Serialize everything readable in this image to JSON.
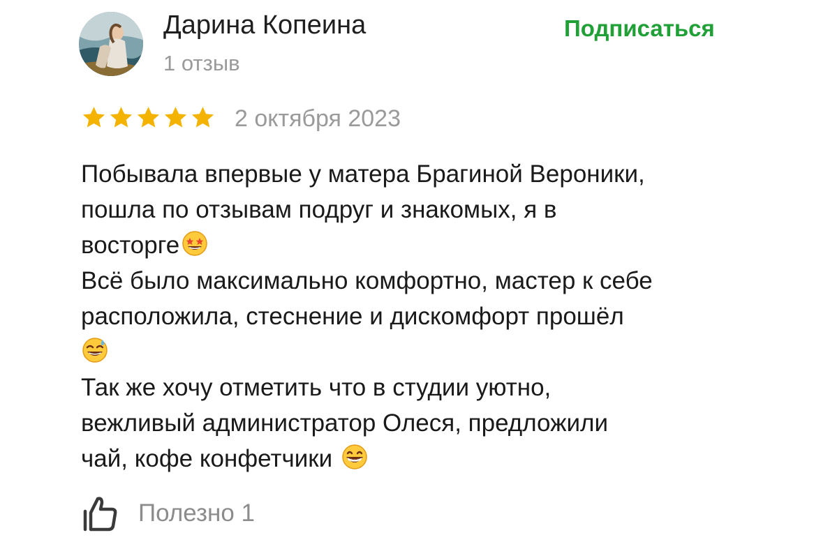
{
  "author": {
    "name": "Дарина Копеина",
    "reviews_count": "1 отзыв",
    "avatar_icon": "user-photo"
  },
  "subscribe_label": "Подписаться",
  "review": {
    "rating": 5,
    "rating_max": 5,
    "date": "2 октября 2023",
    "lines": [
      "Побывала впервые у матера Брагиной Вероники,",
      "пошла по отзывам подруг и знакомых, я в",
      "восторге",
      "Всё было максимально комфортно, мастер к себе",
      "расположила, стеснение и дискомфорт прошёл",
      "",
      "Так же хочу отметить что в студии уютно,",
      "вежливый администратор Олеся, предложили",
      "чай, кофе конфетчики"
    ],
    "emojis": {
      "star_struck": "🤩",
      "sweat_smile": "😅",
      "grin": "😁"
    }
  },
  "helpful": {
    "label": "Полезно",
    "count": "1",
    "icon": "thumbs-up-icon"
  },
  "colors": {
    "accent_green": "#21a038",
    "star_yellow": "#f5b301",
    "muted_text": "#9a9a9a"
  }
}
